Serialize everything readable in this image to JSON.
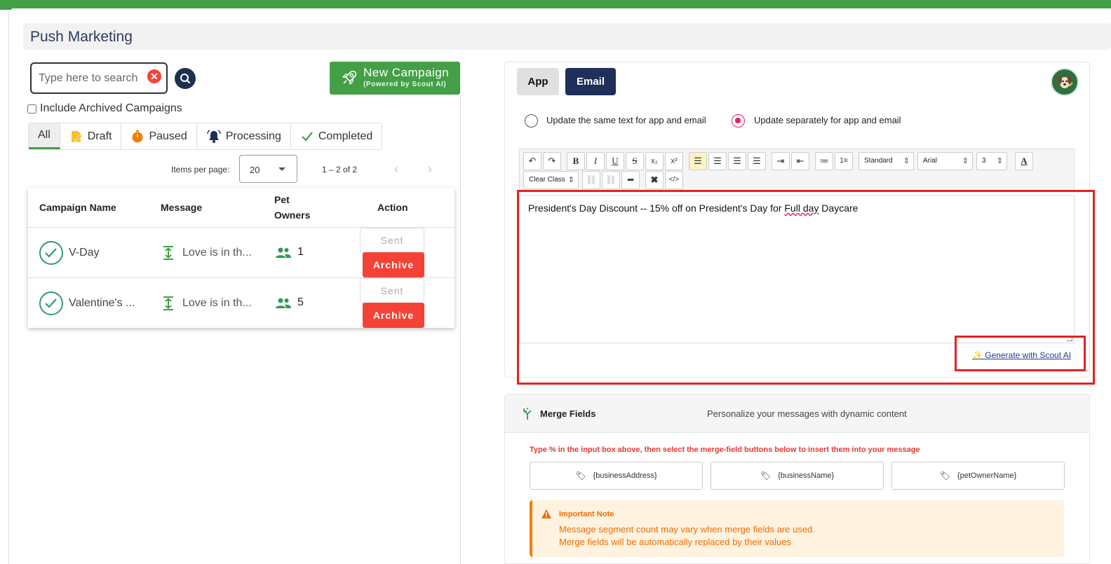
{
  "page": {
    "title": "Push Marketing"
  },
  "search": {
    "placeholder": "Type here to search"
  },
  "new_campaign": {
    "label": "New Campaign",
    "sublabel": "(Powered by Scout AI)"
  },
  "archived": {
    "label": "Include Archived Campaigns",
    "checked": false
  },
  "filters": [
    {
      "label": "All",
      "icon": "",
      "active": true
    },
    {
      "label": "Draft",
      "icon": "draft-icon"
    },
    {
      "label": "Paused",
      "icon": "timer-icon"
    },
    {
      "label": "Processing",
      "icon": "bell-icon"
    },
    {
      "label": "Completed",
      "icon": "check-icon"
    }
  ],
  "pager": {
    "label": "Items per page:",
    "value": "20",
    "range": "1 – 2 of 2",
    "prev": "‹",
    "next": "›"
  },
  "table": {
    "headers": {
      "name": "Campaign Name",
      "message": "Message",
      "owners_line1": "Pet",
      "owners_line2": "Owners",
      "action": "Action"
    },
    "rows": [
      {
        "name": "V-Day",
        "message": "Love is in th...",
        "owners": "1",
        "status": "Sent",
        "archive": "Archive"
      },
      {
        "name": "Valentine's ...",
        "message": "Love is in th...",
        "owners": "5",
        "status": "Sent",
        "archive": "Archive"
      }
    ]
  },
  "channels": {
    "app": "App",
    "email": "Email",
    "selected": "Email"
  },
  "update_mode": {
    "same": "Update the same text for app and email",
    "separate": "Update separately for app and email",
    "selected": "separate"
  },
  "toolbar": {
    "para_style": "Standard",
    "font": "Arial",
    "size": "3",
    "clear_class": "Clear Class"
  },
  "editor": {
    "before": "President's Day Discount -- 15% off on President's Day for ",
    "misspelled": "Full day",
    "after": " Daycare"
  },
  "generate": {
    "label": "Generate with Scout AI"
  },
  "merge": {
    "title": "Merge Fields",
    "subtitle": "Personalize your messages with dynamic content",
    "hint": "Type % in the input box above, then select the merge-field buttons below to insert them into your message",
    "fields": [
      "{businessAddress}",
      "{businessName}",
      "{petOwnerName}"
    ]
  },
  "note": {
    "title": "Important Note",
    "line1": "Message segment count may vary when merge fields are used.",
    "line2": "Merge fields will be automatically replaced by their values"
  },
  "colors": {
    "brand_green": "#43a047",
    "navy": "#1f2f5a",
    "danger": "#f44336",
    "highlight": "#e32222"
  }
}
